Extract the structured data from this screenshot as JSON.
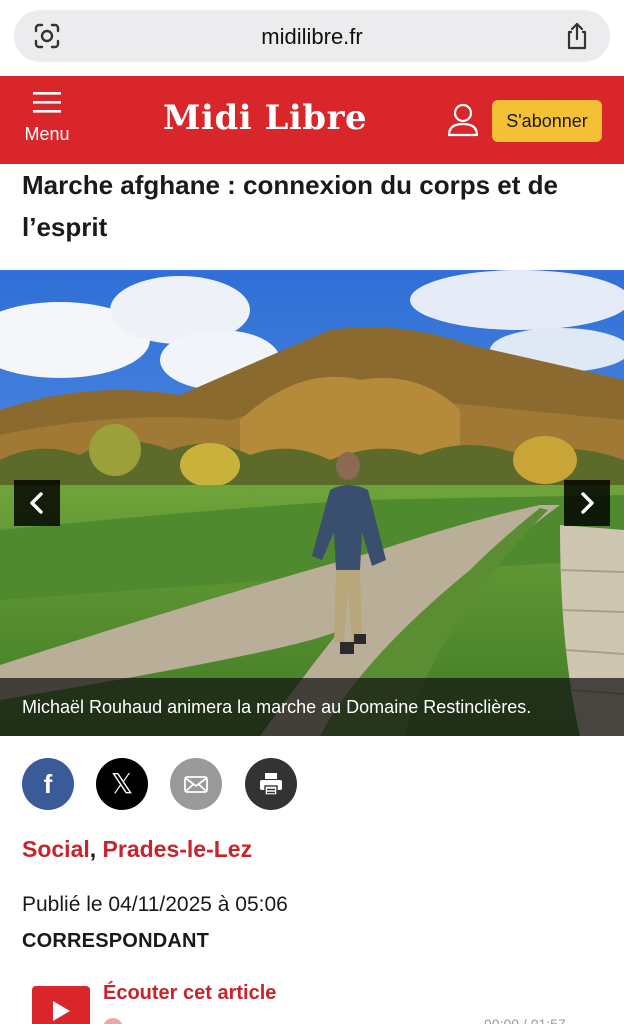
{
  "browser": {
    "url": "midilibre.fr",
    "icons": [
      "screen-capture-icon",
      "share-icon"
    ]
  },
  "header": {
    "menu_label": "Menu",
    "brand": "Midi Libre",
    "subscribe_label": "S'abonner",
    "colors": {
      "brand_red": "#d9262b",
      "subscribe_yellow": "#f4c035"
    }
  },
  "article": {
    "title": "Marche afghane : connexion du corps et de l’esprit",
    "photo_caption": "Michaël Rouhaud animera la marche au Domaine Restinclières.",
    "share": {
      "facebook": "f",
      "x": "𝕏"
    },
    "categories": [
      "Social",
      "Prades-le-Lez"
    ],
    "category_separator": ",",
    "published": "Publié le 04/11/2025 à 05:06",
    "author": "CORRESPONDANT",
    "listen_label": "Écouter cet article",
    "audio_time": "00:00 / 01:57"
  }
}
